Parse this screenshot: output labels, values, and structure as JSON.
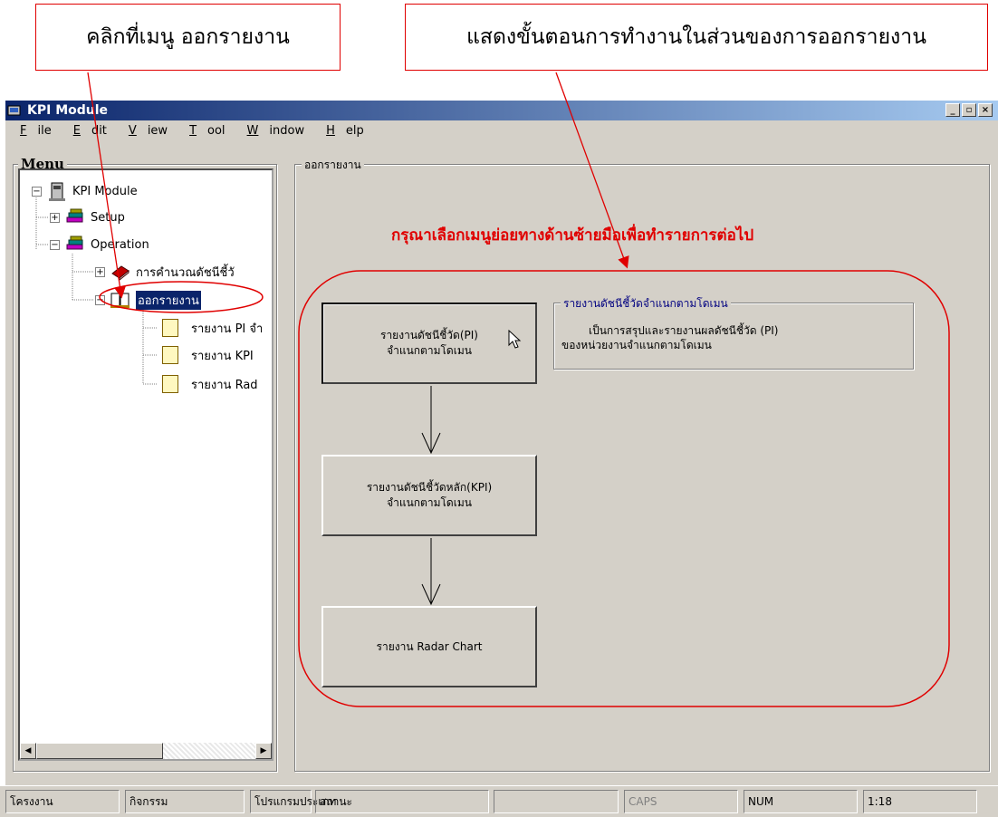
{
  "callouts": {
    "left": "คลิกที่เมนู ออกรายงาน",
    "right": "แสดงขั้นตอนการทำงานในส่วนของการออกรายงาน"
  },
  "window": {
    "title": "KPI Module",
    "controls": [
      "_",
      "▫",
      "×"
    ]
  },
  "menubar": {
    "items": [
      {
        "first": "F",
        "rest": "ile"
      },
      {
        "first": "E",
        "rest": "dit"
      },
      {
        "first": "V",
        "rest": "iew"
      },
      {
        "first": "T",
        "rest": "ool"
      },
      {
        "first": "W",
        "rest": "indow"
      },
      {
        "first": "H",
        "rest": "elp"
      }
    ]
  },
  "menu_panel": {
    "title": "Menu",
    "tree": {
      "root": "KPI Module",
      "setup": "Setup",
      "operation": "Operation",
      "calc": "การคำนวณดัชนีชี้วั",
      "report": "ออกรายงาน",
      "report_pi": "รายงาน PI จำ",
      "report_kpi": "รายงาน KPI ",
      "report_radar": "รายงาน Rad"
    }
  },
  "main_panel": {
    "group_title": "ออกรายงาน",
    "instruction": "กรุณาเลือกเมนูย่อยทางด้านซ้ายมือเพื่อทำรายการต่อไป",
    "flow": {
      "step1_line1": "รายงานดัชนีชี้วัด(PI)",
      "step1_line2": "จำแนกตามโดเมน",
      "step2_line1": "รายงานดัชนีชี้วัดหลัก(KPI)",
      "step2_line2": "จำแนกตามโดเมน",
      "step3": "รายงาน Radar Chart"
    },
    "desc": {
      "title": "รายงานดัชนีชี้วัดจำแนกตามโดเมน",
      "line1": "เป็นการสรุปและรายงานผลดัชนีชี้วัด (PI)",
      "line2": "ของหน่วยงานจำแนกตามโดเมน"
    }
  },
  "statusbar": {
    "project": "โครงงาน",
    "activity": "กิจกรรม",
    "program_type": "โปรแกรมประเภท",
    "status": "สถานะ",
    "empty": "",
    "caps": "CAPS",
    "num": "NUM",
    "time": "1:18"
  },
  "colors": {
    "annotation_red": "#e00000",
    "title_gradient_start": "#0a246a",
    "instruction_red": "#e00000",
    "desc_title_blue": "#000080"
  }
}
